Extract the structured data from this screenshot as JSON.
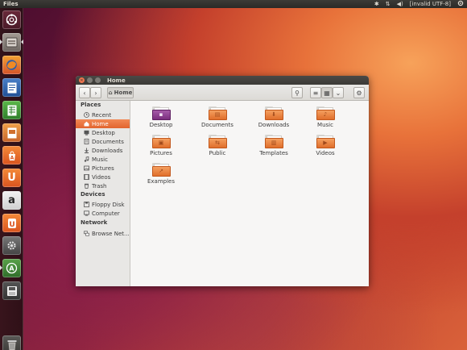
{
  "top_panel": {
    "app_title": "Files",
    "indicators": {
      "bluetooth_icon": "✱",
      "network_icon": "⇅",
      "volume_icon": "◀)",
      "keyboard_text": "[invalid UTF-8]"
    }
  },
  "launcher": {
    "items": [
      {
        "name": "dash-home-icon",
        "glyph": "◎"
      },
      {
        "name": "files-icon",
        "glyph": "▤"
      },
      {
        "name": "firefox-icon",
        "glyph": "●"
      },
      {
        "name": "writer-icon",
        "glyph": "≡"
      },
      {
        "name": "calc-icon",
        "glyph": "▦"
      },
      {
        "name": "impress-icon",
        "glyph": "▭"
      },
      {
        "name": "software-center-icon",
        "glyph": "A"
      },
      {
        "name": "ubuntu-one-icon",
        "glyph": "U"
      },
      {
        "name": "amazon-icon",
        "glyph": "a"
      },
      {
        "name": "ubuntu-one-music-icon",
        "glyph": "U"
      },
      {
        "name": "system-settings-icon",
        "glyph": "✹"
      },
      {
        "name": "software-updater-icon",
        "glyph": "A"
      },
      {
        "name": "removable-drive-icon",
        "glyph": "▬"
      },
      {
        "name": "trash-icon",
        "glyph": "▥"
      }
    ]
  },
  "window": {
    "title": "Home",
    "toolbar": {
      "back_glyph": "‹",
      "forward_glyph": "›",
      "breadcrumb_glyph": "⌂",
      "breadcrumb_label": "Home",
      "search_glyph": "⚲",
      "list_view_glyph": "≡",
      "grid_view_glyph": "▦",
      "view_menu_glyph": "⌄",
      "settings_glyph": "⚙"
    },
    "sidebar": {
      "places_heading": "Places",
      "places": [
        {
          "label": "Recent",
          "icon": "clock-icon"
        },
        {
          "label": "Home",
          "icon": "home-icon",
          "active": true
        },
        {
          "label": "Desktop",
          "icon": "desktop-icon"
        },
        {
          "label": "Documents",
          "icon": "documents-icon"
        },
        {
          "label": "Downloads",
          "icon": "downloads-icon"
        },
        {
          "label": "Music",
          "icon": "music-icon"
        },
        {
          "label": "Pictures",
          "icon": "pictures-icon"
        },
        {
          "label": "Videos",
          "icon": "videos-icon"
        },
        {
          "label": "Trash",
          "icon": "trash-icon"
        }
      ],
      "devices_heading": "Devices",
      "devices": [
        {
          "label": "Floppy Disk",
          "icon": "floppy-icon"
        },
        {
          "label": "Computer",
          "icon": "computer-icon"
        }
      ],
      "network_heading": "Network",
      "network": [
        {
          "label": "Browse Net...",
          "icon": "network-icon"
        }
      ]
    },
    "content": {
      "items": [
        {
          "label": "Desktop",
          "emblem": "▪",
          "style": "purple"
        },
        {
          "label": "Documents",
          "emblem": "▤",
          "style": "orange"
        },
        {
          "label": "Downloads",
          "emblem": "⬇",
          "style": "orange"
        },
        {
          "label": "Music",
          "emblem": "♪",
          "style": "orange"
        },
        {
          "label": "Pictures",
          "emblem": "▣",
          "style": "orange"
        },
        {
          "label": "Public",
          "emblem": "⇆",
          "style": "orange"
        },
        {
          "label": "Templates",
          "emblem": "▥",
          "style": "orange"
        },
        {
          "label": "Videos",
          "emblem": "▶",
          "style": "orange"
        },
        {
          "label": "Examples",
          "emblem": "↗",
          "style": "orange"
        }
      ]
    }
  },
  "colors": {
    "accent": "#e2642e",
    "panel": "#3c3b37",
    "close_button": "#f0754f"
  }
}
